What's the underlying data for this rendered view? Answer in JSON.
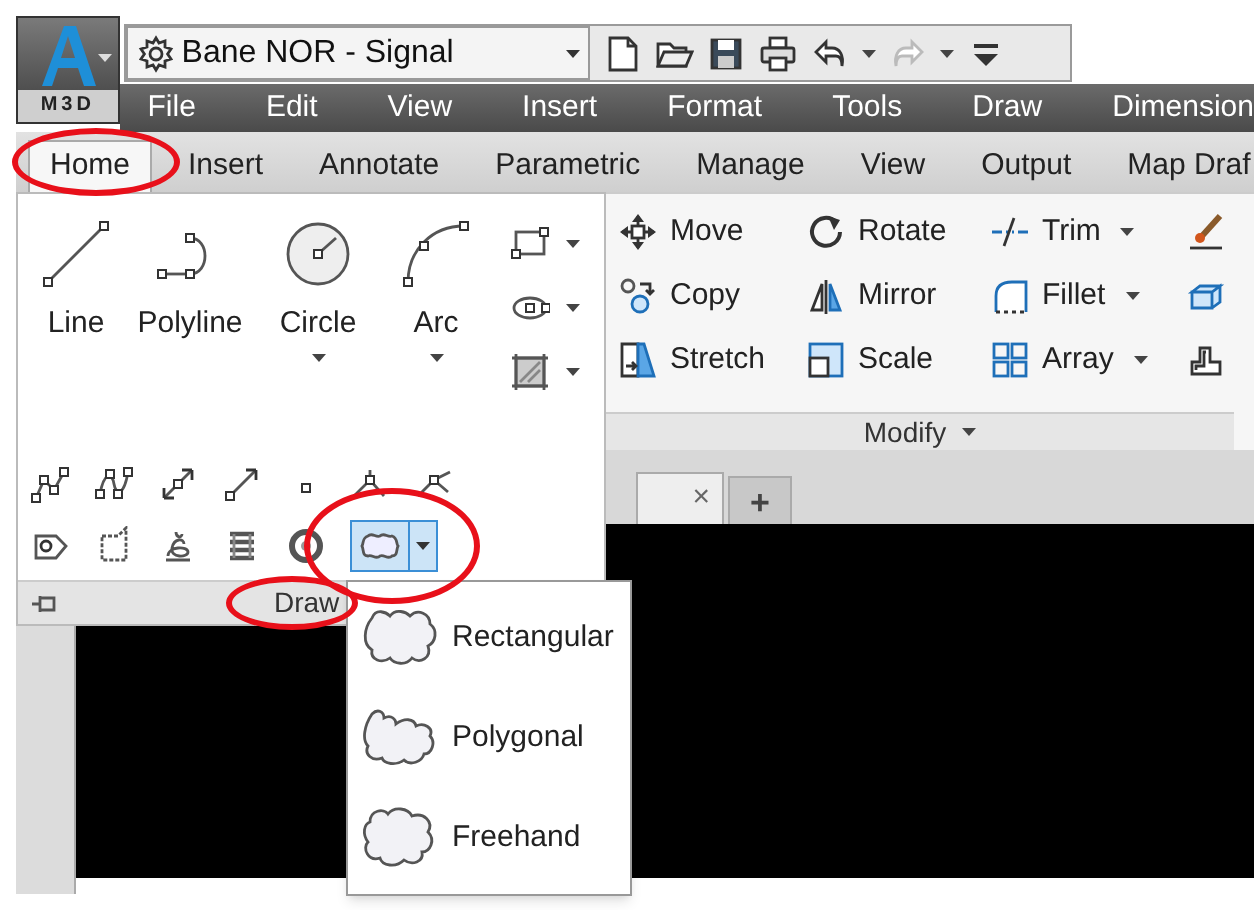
{
  "app_button": {
    "label": "M3D"
  },
  "workspace": {
    "value": "Bane NOR - Signal"
  },
  "menu_bar": [
    "File",
    "Edit",
    "View",
    "Insert",
    "Format",
    "Tools",
    "Draw",
    "Dimension"
  ],
  "ribbon_tabs": [
    {
      "label": "Home",
      "selected": true
    },
    {
      "label": "Insert",
      "selected": false
    },
    {
      "label": "Annotate",
      "selected": false
    },
    {
      "label": "Parametric",
      "selected": false
    },
    {
      "label": "Manage",
      "selected": false
    },
    {
      "label": "View",
      "selected": false
    },
    {
      "label": "Output",
      "selected": false
    },
    {
      "label": "Map Draf",
      "selected": false
    }
  ],
  "draw_panel": {
    "title": "Draw",
    "expanded": true,
    "tools": [
      {
        "label": "Line",
        "dropdown": false
      },
      {
        "label": "Polyline",
        "dropdown": false
      },
      {
        "label": "Circle",
        "dropdown": true
      },
      {
        "label": "Arc",
        "dropdown": true
      }
    ],
    "revision_cloud_button": {
      "pressed": true
    }
  },
  "modify_panel": {
    "title": "Modify",
    "tools": [
      {
        "label": "Move",
        "dropdown": false
      },
      {
        "label": "Rotate",
        "dropdown": false
      },
      {
        "label": "Trim",
        "dropdown": true
      },
      {
        "label": "Copy",
        "dropdown": false
      },
      {
        "label": "Mirror",
        "dropdown": false
      },
      {
        "label": "Fillet",
        "dropdown": true
      },
      {
        "label": "Stretch",
        "dropdown": false
      },
      {
        "label": "Scale",
        "dropdown": false
      },
      {
        "label": "Array",
        "dropdown": true
      }
    ]
  },
  "drawing_tabs": {
    "close": "×",
    "new": "+"
  },
  "revision_cloud_menu": {
    "open": true,
    "items": [
      "Rectangular",
      "Polygonal",
      "Freehand"
    ]
  }
}
